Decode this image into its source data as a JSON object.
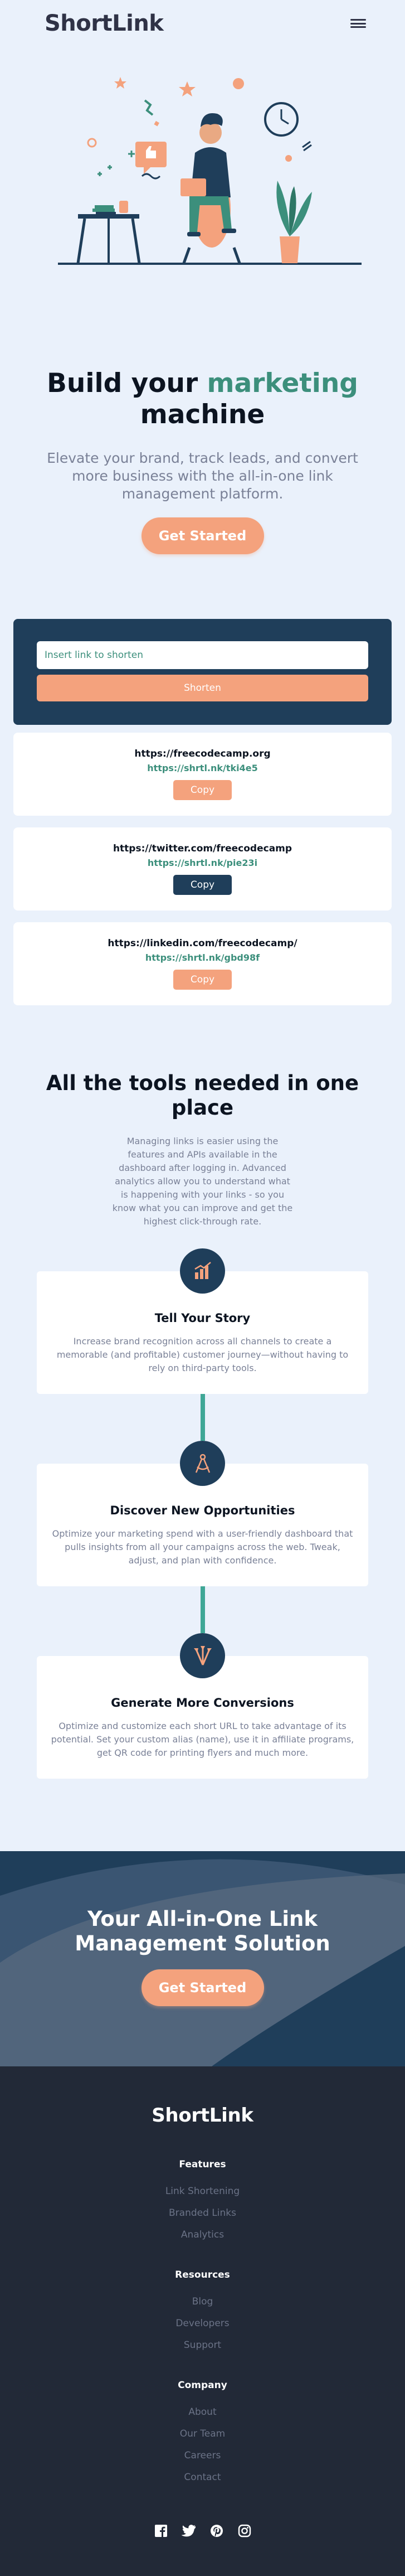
{
  "header": {
    "logo": "ShortLink",
    "menu_icon": "hamburger-icon"
  },
  "hero": {
    "title_prefix": "Build your ",
    "title_accent": "marketing",
    "title_suffix": " machine",
    "subtitle": "Elevate your brand, track leads, and convert more business with the all-in-one link management platform.",
    "cta_label": "Get Started"
  },
  "shortener": {
    "placeholder": "Insert link to shorten",
    "button_label": "Shorten",
    "links": [
      {
        "original": "https://freecodecamp.org",
        "short": "https://shrtl.nk/tki4e5",
        "button": "Copy",
        "state": "default"
      },
      {
        "original": "https://twitter.com/freecodecamp",
        "short": "https://shrtl.nk/pie23i",
        "button": "Copy",
        "state": "copied"
      },
      {
        "original": "https://linkedin.com/freecodecamp/",
        "short": "https://shrtl.nk/gbd98f",
        "button": "Copy",
        "state": "default"
      }
    ]
  },
  "tools": {
    "title": "All the tools needed in one place",
    "description": "Managing links is easier using the features and APIs available in the dashboard after logging in. Advanced analytics allow you to understand what is happening with your links - so you know what you can improve and get the highest click-through rate.",
    "features": [
      {
        "icon": "bar-chart-icon",
        "title": "Tell Your Story",
        "text": "Increase brand recognition across all channels to create a memorable (and profitable) customer journey—without having to rely on third-party tools."
      },
      {
        "icon": "compass-icon",
        "title": "Discover New Opportunities",
        "text": "Optimize your marketing spend with a user-friendly dashboard that pulls insights from all your campaigns across the web. Tweak, adjust, and plan with confidence."
      },
      {
        "icon": "brushes-icon",
        "title": "Generate More Conversions",
        "text": "Optimize and customize each short URL to take advantage of its potential. Set your custom alias (name), use it in affiliate programs, get QR code for printing flyers and much more."
      }
    ]
  },
  "cta": {
    "title": "Your All-in-One Link Management Solution",
    "button_label": "Get Started"
  },
  "footer": {
    "logo": "ShortLink",
    "groups": [
      {
        "heading": "Features",
        "links": [
          "Link Shortening",
          "Branded Links",
          "Analytics"
        ]
      },
      {
        "heading": "Resources",
        "links": [
          "Blog",
          "Developers",
          "Support"
        ]
      },
      {
        "heading": "Company",
        "links": [
          "About",
          "Our Team",
          "Careers",
          "Contact"
        ]
      }
    ],
    "social": [
      "facebook-icon",
      "twitter-icon",
      "pinterest-icon",
      "instagram-icon"
    ]
  },
  "colors": {
    "background": "#eaf1fb",
    "accent_green": "#3c8f7c",
    "accent_orange": "#f4a27d",
    "navy": "#1f3e5a",
    "footer_bg": "#222937",
    "muted_text": "#7a8197"
  }
}
